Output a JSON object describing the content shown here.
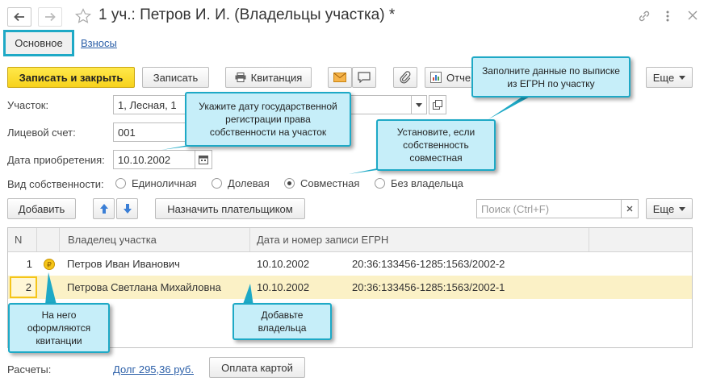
{
  "window": {
    "title": "1 уч.: Петров И. И. (Владельцы участка) *",
    "tabs": [
      "Основное",
      "Взносы"
    ]
  },
  "toolbar": {
    "save_close": "Записать и закрыть",
    "save": "Записать",
    "receipt": "Квитанция",
    "report": "Отче",
    "more": "Еще"
  },
  "form": {
    "plot_label": "Участок:",
    "plot_value": "1, Лесная, 1",
    "account_label": "Лицевой счет:",
    "account_value": "001",
    "date_label": "Дата приобретения:",
    "date_value": "10.10.2002",
    "ownership_label": "Вид собственности:",
    "ownership_options": [
      "Единоличная",
      "Долевая",
      "Совместная",
      "Без владельца"
    ],
    "ownership_selected": "Совместная"
  },
  "list_toolbar": {
    "add": "Добавить",
    "assign_payer": "Назначить плательщиком",
    "search_placeholder": "Поиск (Ctrl+F)",
    "more": "Еще"
  },
  "table": {
    "columns": [
      "N",
      "",
      "Владелец участка",
      "Дата и номер записи ЕГРН"
    ],
    "rows": [
      {
        "n": "1",
        "payer": true,
        "owner": "Петров Иван Иванович",
        "date": "10.10.2002",
        "record": "20:36:133456-1285:1563/2002-2"
      },
      {
        "n": "2",
        "payer": false,
        "owner": "Петрова Светлана Михайловна",
        "date": "10.10.2002",
        "record": "20:36:133456-1285:1563/2002-1"
      }
    ]
  },
  "footer": {
    "calc_label": "Расчеты:",
    "debt_link": "Долг 295,36 руб.",
    "pay_card": "Оплата картой"
  },
  "tooltips": {
    "egrn": "Заполните данные по выписке из ЕГРН по участку",
    "date": "Укажите дату государственной регистрации права собственности на участок",
    "joint": "Установите, если собственность совместная",
    "payer": "На него оформляются квитанции",
    "add_owner": "Добавьте владельца"
  },
  "colors": {
    "primary_button": "#f7d21c",
    "selected_row": "#fbf1c6",
    "tooltip_bg": "#c6eef9",
    "tooltip_border": "#1ea9c6",
    "link": "#2b5fa8"
  }
}
